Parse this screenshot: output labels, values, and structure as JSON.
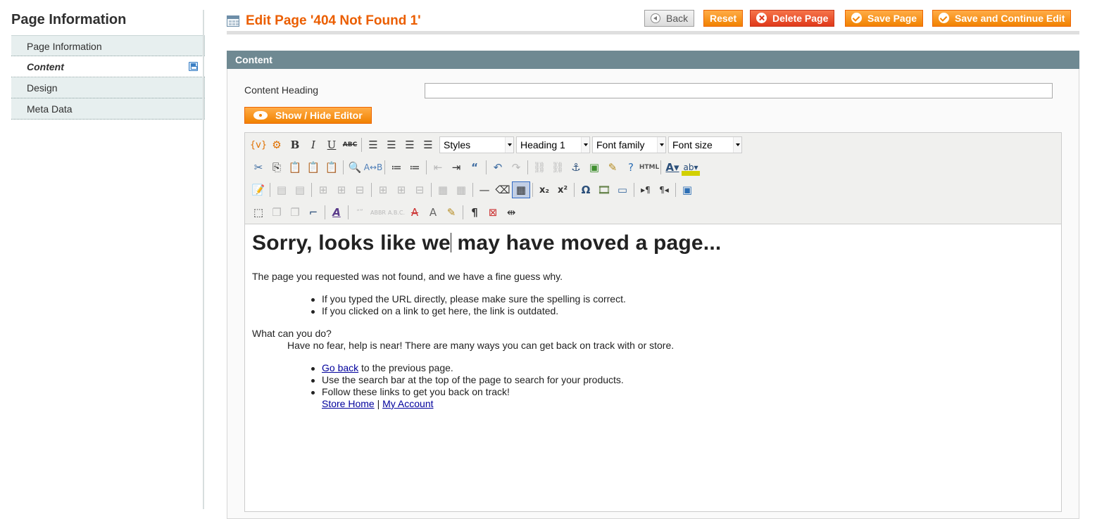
{
  "sidebar": {
    "title": "Page Information",
    "items": [
      {
        "label": "Page Information"
      },
      {
        "label": "Content"
      },
      {
        "label": "Design"
      },
      {
        "label": "Meta Data"
      }
    ]
  },
  "header": {
    "title": "Edit Page '404 Not Found 1'",
    "buttons": {
      "back": "Back",
      "reset": "Reset",
      "delete": "Delete Page",
      "save": "Save Page",
      "save_continue": "Save and Continue Edit"
    }
  },
  "section": {
    "title": "Content",
    "content_heading_label": "Content Heading",
    "content_heading_value": "",
    "toggle_editor": "Show / Hide Editor"
  },
  "toolbar": {
    "styles": "Styles",
    "format": "Heading 1",
    "font_family": "Font family",
    "font_size": "Font size"
  },
  "document": {
    "heading_a": "Sorry, looks like we",
    "heading_b": " may have moved a page...",
    "intro": "The page you requested was not found, and we have a fine guess why.",
    "reasons": [
      "If you typed the URL directly, please make sure the spelling is correct.",
      "If you clicked on a link to get here, the link is outdated."
    ],
    "what_can": "What can you do?",
    "no_fear": "Have no fear, help is near! There are many ways you can get back on track with or store.",
    "go_back_link": "Go back",
    "go_back_rest": " to the previous page.",
    "search_item": "Use the search bar at the top of the page to search for your products.",
    "follow_item": "Follow these links to get you back on track!",
    "store_home": "Store Home",
    "separator": " | ",
    "my_account": "My Account"
  },
  "colors": {
    "accent": "#eb5e00",
    "button": "#f18200",
    "section_header": "#6f8992"
  }
}
